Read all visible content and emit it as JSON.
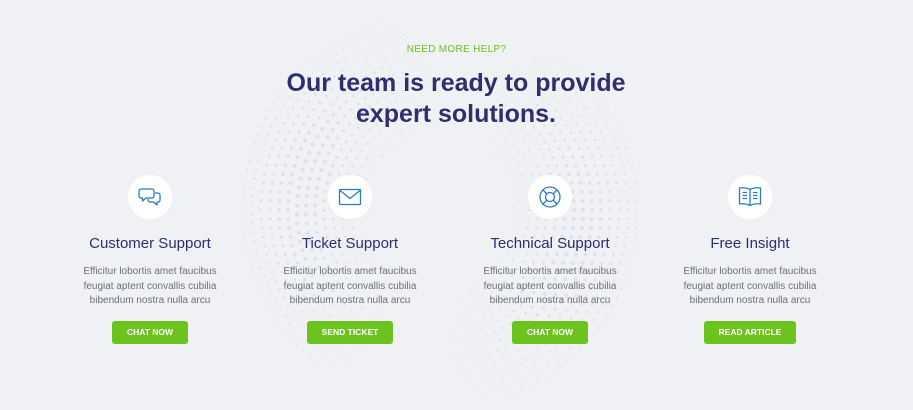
{
  "section": {
    "eyebrow": "NEED MORE HELP?",
    "headline": "Our team is ready to provide expert solutions."
  },
  "colors": {
    "accent": "#6cc21f",
    "heading": "#2d2f6e",
    "icon": "#2b7bbf",
    "background": "#f0f1f4"
  },
  "cards": [
    {
      "icon": "chat-bubbles-icon",
      "title": "Customer Support",
      "text": "Efficitur lobortis amet faucibus feugiat aptent convallis cubilia bibendum nostra nulla arcu",
      "button": "CHAT NOW"
    },
    {
      "icon": "envelope-icon",
      "title": "Ticket Support",
      "text": "Efficitur lobortis amet faucibus feugiat aptent convallis cubilia bibendum nostra nulla arcu",
      "button": "SEND TICKET"
    },
    {
      "icon": "lifebuoy-icon",
      "title": "Technical Support",
      "text": "Efficitur lobortis amet faucibus feugiat aptent convallis cubilia bibendum nostra nulla arcu",
      "button": "CHAT NOW"
    },
    {
      "icon": "book-icon",
      "title": "Free Insight",
      "text": "Efficitur lobortis amet faucibus feugiat aptent convallis cubilia bibendum nostra nulla arcu",
      "button": "READ ARTICLE"
    }
  ]
}
